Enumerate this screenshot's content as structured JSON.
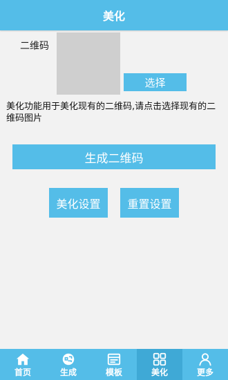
{
  "header": {
    "title": "美化"
  },
  "qr": {
    "label": "二维码"
  },
  "buttons": {
    "select": "选择",
    "generate": "生成二维码",
    "beautify_settings": "美化设置",
    "reset_settings": "重置设置"
  },
  "description": "美化功能用于美化现有的二维码,请点击选择现有的二维码图片",
  "tabs": [
    {
      "label": "首页",
      "icon": "home-icon"
    },
    {
      "label": "生成",
      "icon": "generate-icon"
    },
    {
      "label": "模板",
      "icon": "template-icon"
    },
    {
      "label": "美化",
      "icon": "beautify-icon",
      "active": true
    },
    {
      "label": "更多",
      "icon": "more-icon"
    }
  ],
  "colors": {
    "accent": "#54bde8",
    "accent_active": "#3fa9d6",
    "background": "#f2f2f2",
    "placeholder": "#cfcfcf"
  }
}
